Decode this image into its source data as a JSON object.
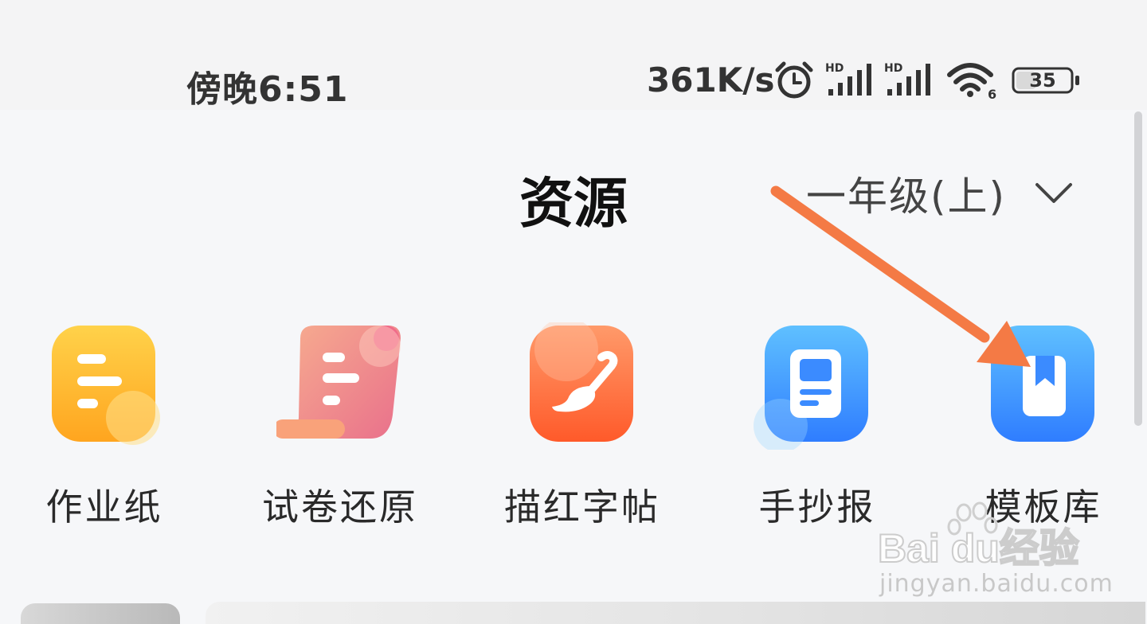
{
  "status_bar": {
    "time": "傍晚6:51",
    "net_speed": "361K/s",
    "battery_level": "35",
    "icons": [
      "alarm-icon",
      "hd-signal-icon",
      "hd-signal-icon",
      "wifi-6-icon",
      "battery-icon"
    ]
  },
  "header": {
    "title": "资源",
    "grade_selector": "一年级(上)"
  },
  "tools": [
    {
      "label": "作业纸",
      "icon": "homework-paper-icon",
      "color": "#ffb020"
    },
    {
      "label": "试卷还原",
      "icon": "exam-scroll-icon",
      "color": "#ef7a90"
    },
    {
      "label": "描红字帖",
      "icon": "brush-icon",
      "color": "#ff6f3c"
    },
    {
      "label": "手抄报",
      "icon": "newspaper-icon",
      "color": "#3b8bff"
    },
    {
      "label": "模板库",
      "icon": "template-book-icon",
      "color": "#3b8bff"
    }
  ],
  "annotation": {
    "icon": "pointer-arrow-icon",
    "color": "#f47a45"
  },
  "watermark": {
    "brand": "Baidu经验",
    "url": "jingyan.baidu.com"
  },
  "colors": {
    "background": "#f6f7f9",
    "status_bar": "#f4f4f5",
    "text": "#222222"
  }
}
